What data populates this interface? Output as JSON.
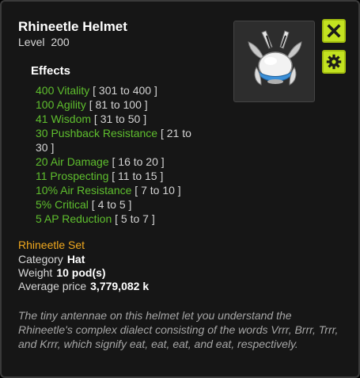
{
  "item": {
    "name": "Rhineetle Helmet",
    "level_label": "Level",
    "level": "200"
  },
  "effects_heading": "Effects",
  "effects": [
    {
      "text": "400 Vitality",
      "range": "[ 301 to 400 ]"
    },
    {
      "text": "100 Agility",
      "range": "[ 81 to 100 ]"
    },
    {
      "text": "41 Wisdom",
      "range": "[ 31 to 50 ]"
    },
    {
      "text": "30 Pushback Resistance",
      "range": "[ 21 to",
      "range_cont": "30 ]"
    },
    {
      "text": "20 Air Damage",
      "range": "[ 16 to 20 ]"
    },
    {
      "text": "11 Prospecting",
      "range": "[ 11 to 15 ]"
    },
    {
      "text": "10% Air Resistance",
      "range": "[ 7 to 10 ]"
    },
    {
      "text": "5% Critical",
      "range": "[ 4 to 5 ]"
    },
    {
      "text": "5 AP Reduction",
      "range": "[ 5 to 7 ]"
    }
  ],
  "set_name": "Rhineetle Set",
  "info": {
    "category_label": "Category",
    "category": "Hat",
    "weight_label": "Weight",
    "weight": "10 pod(s)",
    "price_label": "Average price",
    "price": "3,779,082 k"
  },
  "description": "The tiny antennae on this helmet let you understand the Rhineetle's complex dialect consisting of the words Vrrr, Brrr, Trrr, and Krrr, which signify eat, eat, eat, and eat, respectively.",
  "icons": {
    "close": "close-icon",
    "settings": "gear-icon",
    "item": "helmet-image"
  },
  "colors": {
    "effect_green": "#5fbf2e",
    "set_orange": "#f0a81e",
    "button_accent": "#c3e220"
  }
}
